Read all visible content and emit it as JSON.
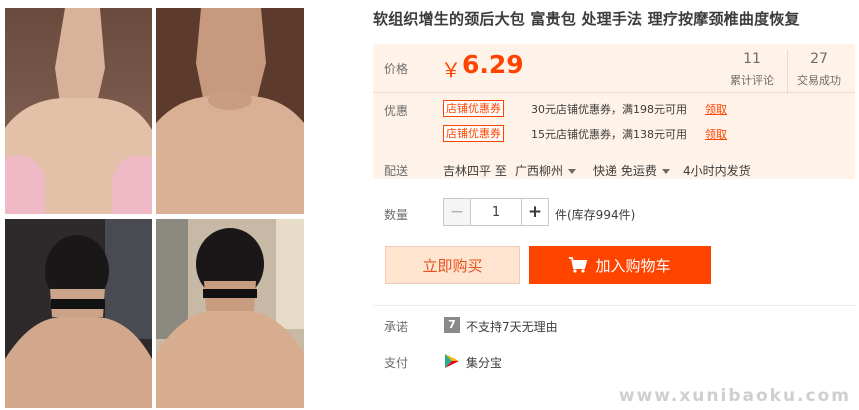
{
  "product": {
    "title": "软组织增生的颈后大包 富贵包 处理手法 理疗按摩颈椎曲度恢复"
  },
  "price": {
    "label": "价格",
    "currency": "￥",
    "value": "6.29"
  },
  "stats": [
    {
      "value": "11",
      "label": "累计评论"
    },
    {
      "value": "27",
      "label": "交易成功"
    }
  ],
  "coupons": {
    "label": "优惠",
    "items": [
      {
        "tag": "店铺优惠券",
        "text": "30元店铺优惠券，满198元可用",
        "link": "领取"
      },
      {
        "tag": "店铺优惠券",
        "text": "15元店铺优惠券，满138元可用",
        "link": "领取"
      }
    ]
  },
  "delivery": {
    "label": "配送",
    "origin": "吉林四平 至",
    "destination": "广西柳州",
    "method": "快递 免运费",
    "dispatch": "4小时内发货"
  },
  "quantity": {
    "label": "数量",
    "minus": "−",
    "value": "1",
    "plus": "+",
    "stock": "件(库存994件)"
  },
  "actions": {
    "buy_now": "立即购买",
    "add_to_cart": "加入购物车"
  },
  "promise": {
    "label": "承诺",
    "icon_text": "7",
    "text": "不支持7天无理由"
  },
  "payment": {
    "label": "支付",
    "text": "集分宝"
  },
  "watermark": "www.xunibaoku.com",
  "colors": {
    "accent": "#ff4400",
    "price_bg": "#fff2e8",
    "buy_bg": "#ffe4d0"
  },
  "icons": {
    "cart": "shopping-cart-icon",
    "promise": "seven-day-badge-icon",
    "payment": "jifenbao-icon",
    "dropdown": "caret-down-icon"
  }
}
